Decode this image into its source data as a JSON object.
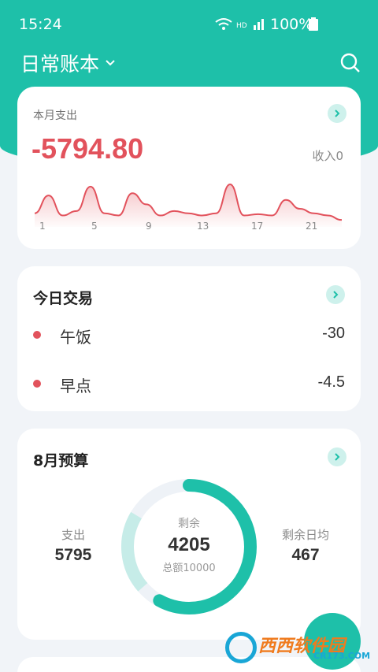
{
  "status_bar": {
    "time": "15:24",
    "network": "HD",
    "battery": "100%"
  },
  "app_bar": {
    "title": "日常账本"
  },
  "month_card": {
    "label": "本月支出",
    "amount": "-5794.80",
    "income": "收入0",
    "x_ticks": [
      "1",
      "5",
      "9",
      "13",
      "17",
      "21"
    ]
  },
  "chart_data": {
    "type": "area",
    "x": [
      1,
      2,
      3,
      4,
      5,
      6,
      7,
      8,
      9,
      10,
      11,
      12,
      13,
      14,
      15,
      16,
      17,
      18,
      19,
      20,
      21,
      22,
      23
    ],
    "values": [
      20,
      60,
      15,
      25,
      80,
      20,
      15,
      65,
      40,
      15,
      25,
      20,
      15,
      20,
      85,
      15,
      18,
      15,
      50,
      30,
      20,
      15,
      5
    ],
    "xlabel": "",
    "ylabel": "",
    "color": "#e2525c"
  },
  "today_card": {
    "title": "今日交易",
    "transactions": [
      {
        "name": "午饭",
        "amount": "-30"
      },
      {
        "name": "早点",
        "amount": "-4.5"
      }
    ]
  },
  "budget_card": {
    "title": "8月预算",
    "spent_label": "支出",
    "spent_value": "5795",
    "remain_label": "剩余",
    "remain_value": "4205",
    "total": "总额10000",
    "daily_label": "剩余日均",
    "daily_value": "467",
    "remain_fraction": 0.58
  },
  "watermark": {
    "text": "西西软件园",
    "sub": "CR173.COM"
  },
  "colors": {
    "brand": "#1ec0a9",
    "expense": "#e2525c"
  }
}
